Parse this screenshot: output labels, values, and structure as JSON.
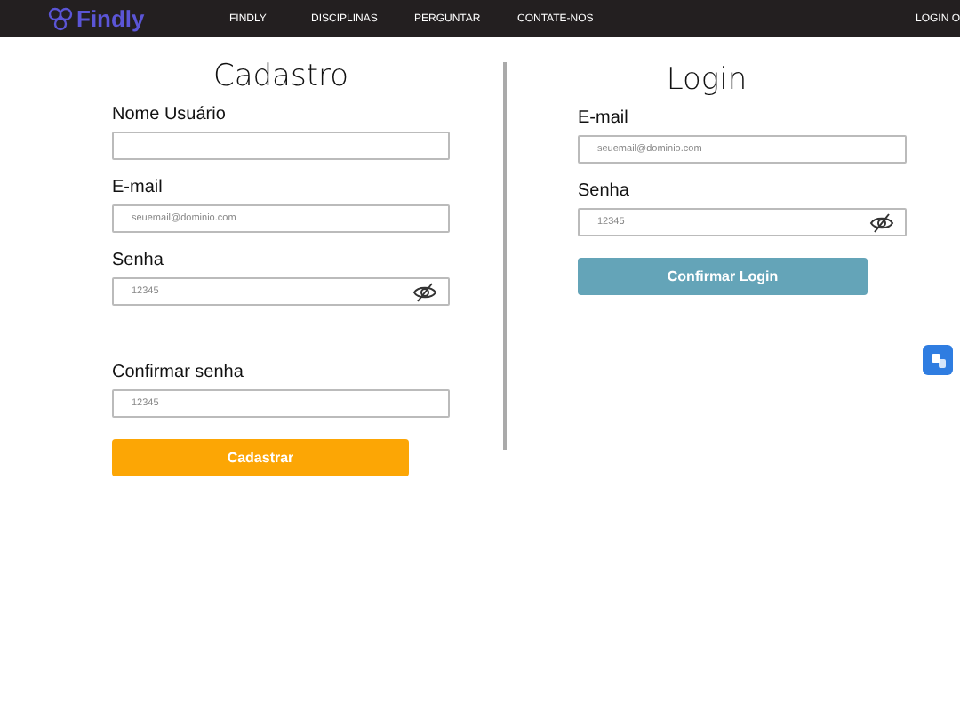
{
  "navbar": {
    "logo": "Findly",
    "links": [
      "FINDLY",
      "DISCIPLINAS",
      "PERGUNTAR",
      "CONTATE-NOS"
    ],
    "right_link": "LOGIN O"
  },
  "register": {
    "title": "Cadastro",
    "fields": [
      {
        "label": "Nome Usuário",
        "reveal_icon": false
      },
      {
        "label": "E-mail",
        "placeholder": "seuemail@dominio.com",
        "reveal_icon": false
      },
      {
        "label": "Senha",
        "placeholder": "12345",
        "reveal_icon": true
      },
      {
        "label": "Confirmar senha",
        "placeholder": "12345",
        "reveal_icon": false
      }
    ],
    "button": "Cadastrar"
  },
  "login": {
    "title": "Login",
    "fields": [
      {
        "label": "E-mail",
        "placeholder": "seuemail@dominio.com",
        "reveal_icon": false
      },
      {
        "label": "Senha",
        "placeholder": "12345",
        "reveal_icon": true
      }
    ],
    "button": "Confirmar Login"
  }
}
